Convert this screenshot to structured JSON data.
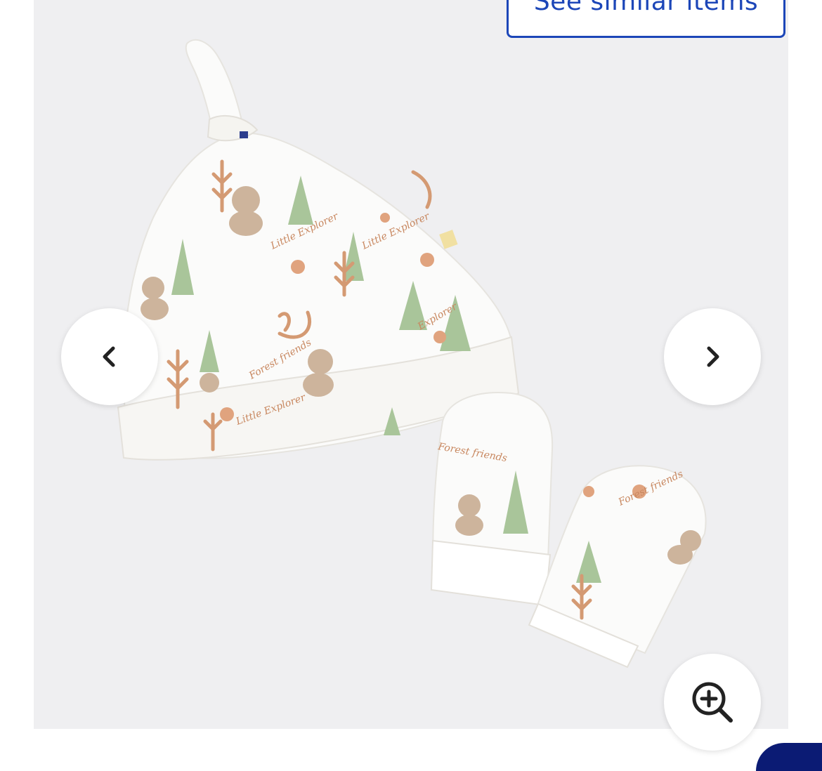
{
  "gallery": {
    "see_similar_label": "See similar items",
    "image_name": "baby-hat-and-mittens-set",
    "prev_icon": "chevron-left-icon",
    "next_icon": "chevron-right-icon",
    "zoom_icon": "zoom-in-icon"
  },
  "colors": {
    "accent": "#1c46b8",
    "gallery_bg": "#efeff1",
    "brand_dark": "#0b1b74"
  }
}
